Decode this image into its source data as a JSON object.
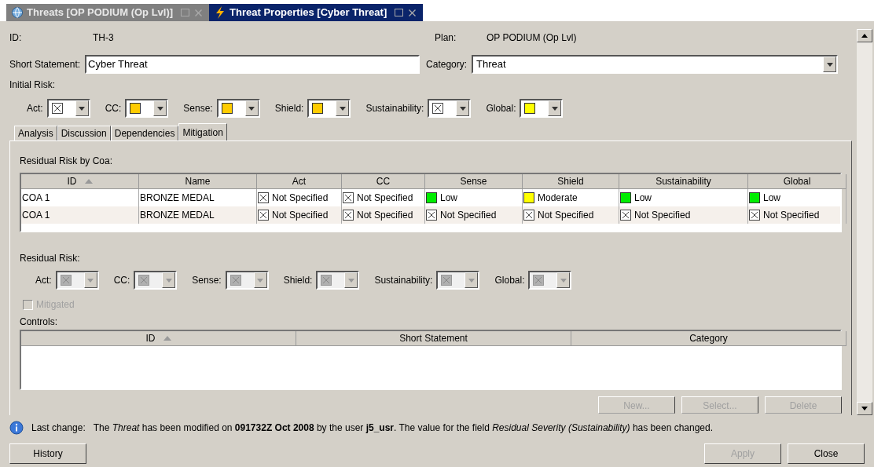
{
  "tabs": [
    {
      "label": "Threats [OP PODIUM (Op Lvl)]",
      "selected": false,
      "kind": "globe"
    },
    {
      "label": "Threat Properties [Cyber Threat]",
      "selected": true,
      "kind": "bolt"
    }
  ],
  "fields": {
    "id_label": "ID:",
    "id_value": "TH-3",
    "plan_label": "Plan:",
    "plan_value": "OP PODIUM (Op Lvl)",
    "short_statement_label": "Short Statement:",
    "short_statement_value": "Cyber Threat",
    "category_label": "Category:",
    "category_value": "Threat"
  },
  "initial_risk": {
    "title": "Initial Risk:",
    "disabled": false,
    "items": [
      {
        "label": "Act:",
        "kind": "none"
      },
      {
        "label": "CC:",
        "kind": "color",
        "color": "#ffcc00"
      },
      {
        "label": "Sense:",
        "kind": "color",
        "color": "#ffcc00"
      },
      {
        "label": "Shield:",
        "kind": "color",
        "color": "#ffcc00"
      },
      {
        "label": "Sustainability:",
        "kind": "none"
      },
      {
        "label": "Global:",
        "kind": "color",
        "color": "#ffff00"
      }
    ]
  },
  "section_tabs": [
    {
      "label": "Analysis",
      "selected": false
    },
    {
      "label": "Discussion",
      "selected": false
    },
    {
      "label": "Dependencies",
      "selected": false
    },
    {
      "label": "Mitigation",
      "selected": true
    }
  ],
  "residual_by_coa": {
    "title": "Residual Risk by Coa:",
    "columns": [
      {
        "label": "ID",
        "sorted": true
      },
      {
        "label": "Name",
        "sorted": false
      },
      {
        "label": "Act",
        "sorted": false
      },
      {
        "label": "CC",
        "sorted": false
      },
      {
        "label": "Sense",
        "sorted": false
      },
      {
        "label": "Shield",
        "sorted": false
      },
      {
        "label": "Sustainability",
        "sorted": false
      },
      {
        "label": "Global",
        "sorted": false
      }
    ],
    "rows": [
      {
        "cells": [
          {
            "kind": "text",
            "text": "COA 1"
          },
          {
            "kind": "text",
            "text": "BRONZE MEDAL"
          },
          {
            "kind": "none",
            "text": "Not Specified"
          },
          {
            "kind": "none",
            "text": "Not Specified"
          },
          {
            "kind": "color",
            "color": "#00ee00",
            "text": "Low"
          },
          {
            "kind": "color",
            "color": "#ffff00",
            "text": "Moderate"
          },
          {
            "kind": "color",
            "color": "#00ee00",
            "text": "Low"
          },
          {
            "kind": "color",
            "color": "#00ee00",
            "text": "Low"
          }
        ]
      },
      {
        "cells": [
          {
            "kind": "text",
            "text": "COA 1"
          },
          {
            "kind": "text",
            "text": "BRONZE MEDAL"
          },
          {
            "kind": "none",
            "text": "Not Specified"
          },
          {
            "kind": "none",
            "text": "Not Specified"
          },
          {
            "kind": "none",
            "text": "Not Specified"
          },
          {
            "kind": "none",
            "text": "Not Specified"
          },
          {
            "kind": "none",
            "text": "Not Specified"
          },
          {
            "kind": "none",
            "text": "Not Specified"
          }
        ]
      }
    ]
  },
  "residual_risk": {
    "title": "Residual Risk:",
    "disabled": true,
    "items": [
      {
        "label": "Act:",
        "kind": "none"
      },
      {
        "label": "CC:",
        "kind": "none"
      },
      {
        "label": "Sense:",
        "kind": "none"
      },
      {
        "label": "Shield:",
        "kind": "none"
      },
      {
        "label": "Sustainability:",
        "kind": "none"
      },
      {
        "label": "Global:",
        "kind": "none"
      }
    ]
  },
  "mitigated": {
    "label": "Mitigated",
    "checked": false,
    "disabled": true
  },
  "controls": {
    "title": "Controls:",
    "columns": [
      {
        "label": "ID",
        "sorted": true
      },
      {
        "label": "Short Statement",
        "sorted": false
      },
      {
        "label": "Category",
        "sorted": false
      }
    ],
    "buttons": [
      {
        "label": "New...",
        "disabled": true
      },
      {
        "label": "Select...",
        "disabled": true
      },
      {
        "label": "Delete",
        "disabled": true
      }
    ]
  },
  "status": {
    "label": "Last change:",
    "message": "The *Threat* has been modified on **091732Z Oct 2008** by the user **j5_usr**. The value for the field *Residual Severity (Sustainability)* has been changed."
  },
  "buttons": [
    {
      "label": "History",
      "disabled": false
    },
    {
      "label": "Apply",
      "disabled": true
    },
    {
      "label": "Close",
      "disabled": false
    }
  ]
}
